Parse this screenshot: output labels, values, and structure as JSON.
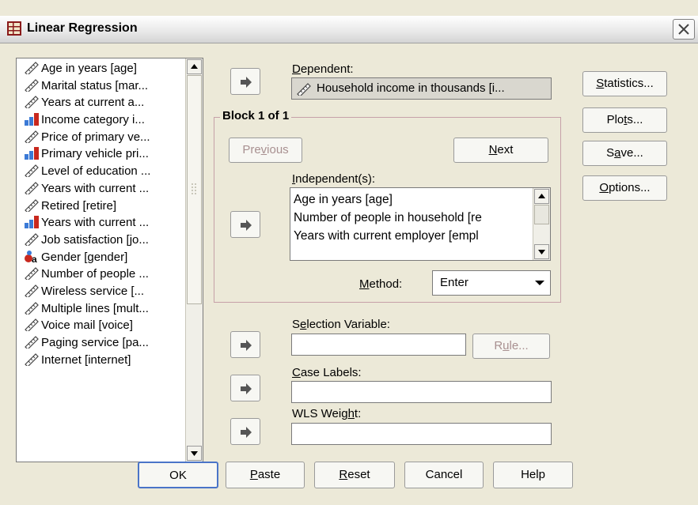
{
  "window": {
    "title": "Linear Regression",
    "close_label": "X"
  },
  "variables": [
    {
      "label": "Age in years [age]",
      "icon": "scale-icon"
    },
    {
      "label": "Marital status [mar...",
      "icon": "scale-icon"
    },
    {
      "label": "Years at current a...",
      "icon": "scale-icon"
    },
    {
      "label": "Income category i...",
      "icon": "ordinal-icon"
    },
    {
      "label": "Price of primary ve...",
      "icon": "scale-icon"
    },
    {
      "label": "Primary vehicle pri...",
      "icon": "ordinal-icon"
    },
    {
      "label": "Level of education ...",
      "icon": "scale-icon"
    },
    {
      "label": "Years with current ...",
      "icon": "scale-icon"
    },
    {
      "label": "Retired [retire]",
      "icon": "scale-icon"
    },
    {
      "label": "Years with current ...",
      "icon": "ordinal-icon"
    },
    {
      "label": "Job satisfaction [jo...",
      "icon": "scale-icon"
    },
    {
      "label": "Gender [gender]",
      "icon": "nominal-icon"
    },
    {
      "label": "Number of people ...",
      "icon": "scale-icon"
    },
    {
      "label": "Wireless service [...",
      "icon": "scale-icon"
    },
    {
      "label": "Multiple lines [mult...",
      "icon": "scale-icon"
    },
    {
      "label": "Voice mail [voice]",
      "icon": "scale-icon"
    },
    {
      "label": "Paging service [pa...",
      "icon": "scale-icon"
    },
    {
      "label": "Internet [internet]",
      "icon": "scale-icon"
    }
  ],
  "dependent": {
    "label": "Dependent:",
    "value": "Household income in thousands [i..."
  },
  "block": {
    "legend": "Block 1 of 1",
    "previous": "Previous",
    "next": "Next",
    "independents_label": "Independent(s):",
    "independents": [
      "Age in years [age]",
      "Number of people in household [re",
      "Years with current employer [empl"
    ],
    "method_label": "Method:",
    "method_value": "Enter"
  },
  "selection": {
    "label": "Selection Variable:",
    "value": "",
    "rule": "Rule..."
  },
  "case_labels": {
    "label": "Case Labels:",
    "value": ""
  },
  "wls": {
    "label": "WLS Weight:",
    "value": ""
  },
  "side_buttons": {
    "statistics": "Statistics...",
    "plots": "Plots...",
    "save": "Save...",
    "options": "Options..."
  },
  "bottom_buttons": {
    "ok": "OK",
    "paste": "Paste",
    "reset": "Reset",
    "cancel": "Cancel",
    "help": "Help"
  }
}
